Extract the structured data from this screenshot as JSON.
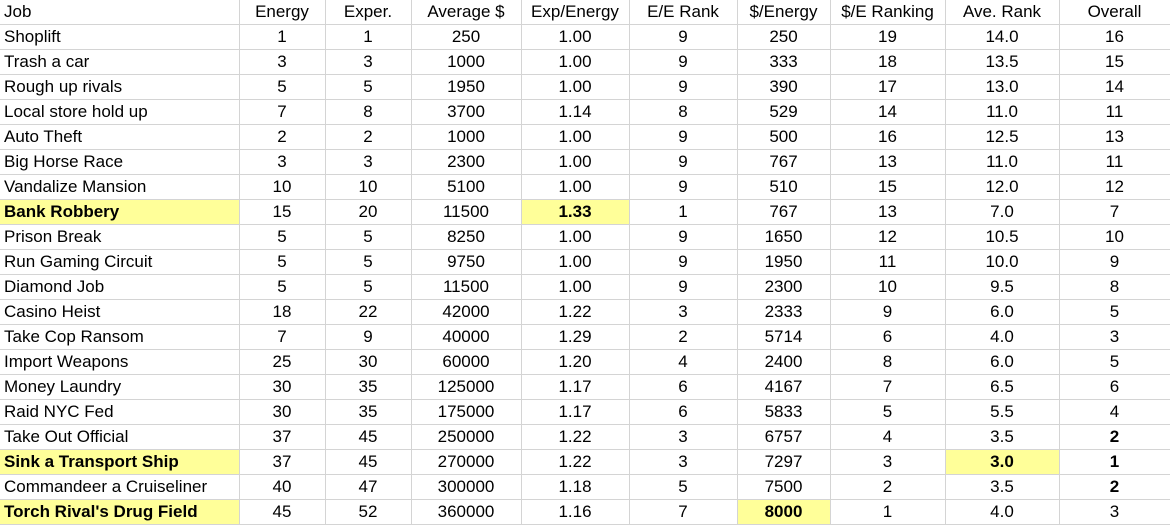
{
  "headers": [
    "Job",
    "Energy",
    "Exper.",
    "Average $",
    "Exp/Energy",
    "E/E Rank",
    "$/Energy",
    "$/E Ranking",
    "Ave. Rank",
    "Overall"
  ],
  "rows": [
    [
      "Shoplift",
      "1",
      "1",
      "250",
      "1.00",
      "9",
      "250",
      "19",
      "14.0",
      "16"
    ],
    [
      "Trash a car",
      "3",
      "3",
      "1000",
      "1.00",
      "9",
      "333",
      "18",
      "13.5",
      "15"
    ],
    [
      "Rough up rivals",
      "5",
      "5",
      "1950",
      "1.00",
      "9",
      "390",
      "17",
      "13.0",
      "14"
    ],
    [
      "Local store hold up",
      "7",
      "8",
      "3700",
      "1.14",
      "8",
      "529",
      "14",
      "11.0",
      "11"
    ],
    [
      "Auto Theft",
      "2",
      "2",
      "1000",
      "1.00",
      "9",
      "500",
      "16",
      "12.5",
      "13"
    ],
    [
      "Big Horse Race",
      "3",
      "3",
      "2300",
      "1.00",
      "9",
      "767",
      "13",
      "11.0",
      "11"
    ],
    [
      "Vandalize Mansion",
      "10",
      "10",
      "5100",
      "1.00",
      "9",
      "510",
      "15",
      "12.0",
      "12"
    ],
    [
      "Bank Robbery",
      "15",
      "20",
      "11500",
      "1.33",
      "1",
      "767",
      "13",
      "7.0",
      "7"
    ],
    [
      "Prison Break",
      "5",
      "5",
      "8250",
      "1.00",
      "9",
      "1650",
      "12",
      "10.5",
      "10"
    ],
    [
      "Run Gaming Circuit",
      "5",
      "5",
      "9750",
      "1.00",
      "9",
      "1950",
      "11",
      "10.0",
      "9"
    ],
    [
      "Diamond Job",
      "5",
      "5",
      "11500",
      "1.00",
      "9",
      "2300",
      "10",
      "9.5",
      "8"
    ],
    [
      "Casino Heist",
      "18",
      "22",
      "42000",
      "1.22",
      "3",
      "2333",
      "9",
      "6.0",
      "5"
    ],
    [
      "Take Cop Ransom",
      "7",
      "9",
      "40000",
      "1.29",
      "2",
      "5714",
      "6",
      "4.0",
      "3"
    ],
    [
      "Import Weapons",
      "25",
      "30",
      "60000",
      "1.20",
      "4",
      "2400",
      "8",
      "6.0",
      "5"
    ],
    [
      "Money Laundry",
      "30",
      "35",
      "125000",
      "1.17",
      "6",
      "4167",
      "7",
      "6.5",
      "6"
    ],
    [
      "Raid NYC Fed",
      "30",
      "35",
      "175000",
      "1.17",
      "6",
      "5833",
      "5",
      "5.5",
      "4"
    ],
    [
      "Take Out Official",
      "37",
      "45",
      "250000",
      "1.22",
      "3",
      "6757",
      "4",
      "3.5",
      "2"
    ],
    [
      "Sink a Transport Ship",
      "37",
      "45",
      "270000",
      "1.22",
      "3",
      "7297",
      "3",
      "3.0",
      "1"
    ],
    [
      "Commandeer a Cruiseliner",
      "40",
      "47",
      "300000",
      "1.18",
      "5",
      "7500",
      "2",
      "3.5",
      "2"
    ],
    [
      "Torch Rival's Drug Field",
      "45",
      "52",
      "360000",
      "1.16",
      "7",
      "8000",
      "1",
      "4.0",
      "3"
    ]
  ],
  "highlight_color": "#ffff99",
  "highlighted_cells": [
    [
      7,
      0
    ],
    [
      7,
      4
    ],
    [
      17,
      0
    ],
    [
      17,
      8
    ],
    [
      19,
      0
    ],
    [
      19,
      6
    ]
  ],
  "bold_cells": [
    [
      7,
      0
    ],
    [
      7,
      4
    ],
    [
      16,
      9
    ],
    [
      17,
      0
    ],
    [
      17,
      8
    ],
    [
      17,
      9
    ],
    [
      18,
      9
    ],
    [
      19,
      0
    ],
    [
      19,
      6
    ]
  ]
}
